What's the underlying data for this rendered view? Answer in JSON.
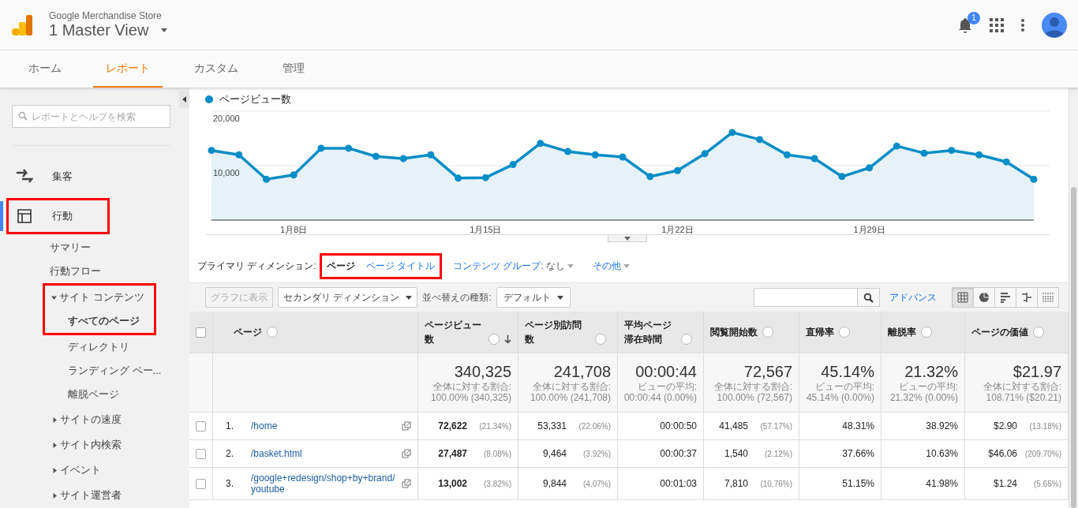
{
  "header": {
    "property": "Google Merchandise Store",
    "view": "1 Master View",
    "notification_count": "1"
  },
  "tabs": [
    {
      "label": "ホーム",
      "selected": false
    },
    {
      "label": "レポート",
      "selected": true
    },
    {
      "label": "カスタム",
      "selected": false
    },
    {
      "label": "管理",
      "selected": false
    }
  ],
  "sidebar": {
    "search_placeholder": "レポートとヘルプを検索",
    "sections": [
      {
        "kind": "acquisition",
        "label": "集客",
        "selected": false,
        "highlighted": false
      },
      {
        "kind": "behavior",
        "label": "行動",
        "selected": true,
        "highlighted": true,
        "children": [
          {
            "label": "サマリー",
            "selected": false
          },
          {
            "label": "行動フロー",
            "selected": false
          },
          {
            "label": "サイト コンテンツ",
            "expanded": true,
            "highlighted": true,
            "children": [
              {
                "label": "すべてのページ",
                "selected": true
              },
              {
                "label": "ディレクトリ",
                "selected": false
              },
              {
                "label": "ランディング ペー...",
                "selected": false
              },
              {
                "label": "離脱ページ",
                "selected": false
              }
            ]
          },
          {
            "label": "サイトの速度",
            "expanded": false
          },
          {
            "label": "サイト内検索",
            "expanded": false
          },
          {
            "label": "イベント",
            "expanded": false
          },
          {
            "label": "サイト運営者",
            "expanded": false
          }
        ]
      }
    ]
  },
  "chart": {
    "chart_data": {
      "type": "area",
      "categories": [
        null,
        null,
        null,
        "1月8日",
        null,
        null,
        null,
        null,
        null,
        null,
        "1月15日",
        null,
        null,
        null,
        null,
        null,
        null,
        "1月22日",
        null,
        null,
        null,
        null,
        null,
        null,
        "1月29日",
        null,
        null,
        null,
        null,
        null,
        null
      ],
      "yticks": [
        {
          "value": 10000,
          "label": "10,000"
        },
        {
          "value": 20000,
          "label": "20,000"
        }
      ],
      "ylim": [
        0,
        20000
      ],
      "series": [
        {
          "name": "ページビュー数",
          "color": "#058dc7",
          "values": [
            12800,
            12000,
            7500,
            8300,
            13200,
            13200,
            11700,
            11300,
            12000,
            7700,
            7800,
            10200,
            14100,
            12600,
            12000,
            11600,
            8000,
            9100,
            12200,
            16100,
            14800,
            12000,
            11300,
            8000,
            9600,
            13600,
            12300,
            12800,
            12000,
            10700,
            7500
          ]
        }
      ]
    }
  },
  "primary_dimension": {
    "label": "プライマリ ディメンション:",
    "highlighted": true,
    "options": [
      {
        "label": "ページ",
        "selected": true
      },
      {
        "label": "ページ タイトル",
        "selected": false
      }
    ],
    "content_group": {
      "label": "コンテンツ グループ:",
      "value": "なし"
    },
    "more": "その他"
  },
  "toolbar": {
    "graph_button": {
      "label": "グラフに表示",
      "disabled": true
    },
    "secondary_dimension": "セカンダリ ディメンション",
    "sort_label": "並べ替えの種類:",
    "sort_value": "デフォルト",
    "advanced": "アドバンス",
    "view_modes": [
      {
        "kind": "table",
        "selected": true
      },
      {
        "kind": "pie",
        "selected": false
      },
      {
        "kind": "bars",
        "selected": false
      },
      {
        "kind": "comparison",
        "selected": false
      },
      {
        "kind": "pivot",
        "selected": false
      }
    ]
  },
  "table": {
    "select_all_checked": false,
    "columns": [
      {
        "label": "ページ",
        "sorted": false
      },
      {
        "label": "ページビュー数",
        "sorted": true
      },
      {
        "label": "ページ別訪問数",
        "sorted": false
      },
      {
        "label": "平均ページ滞在時間",
        "sorted": false
      },
      {
        "label": "閲覧開始数",
        "sorted": false
      },
      {
        "label": "直帰率",
        "sorted": false
      },
      {
        "label": "離脱率",
        "sorted": false
      },
      {
        "label": "ページの価値",
        "sorted": false
      }
    ],
    "totals": [
      {
        "value": "340,325",
        "caption": "全体に対する割合:",
        "detail": "100.00% (340,325)"
      },
      {
        "value": "241,708",
        "caption": "全体に対する割合:",
        "detail": "100.00% (241,708)"
      },
      {
        "value": "00:00:44",
        "caption": "ビューの平均:",
        "detail": "00:00:44 (0.00%)"
      },
      {
        "value": "72,567",
        "caption": "全体に対する割合:",
        "detail": "100.00% (72,567)"
      },
      {
        "value": "45.14%",
        "caption": "ビューの平均:",
        "detail": "45.14% (0.00%)"
      },
      {
        "value": "21.32%",
        "caption": "ビューの平均:",
        "detail": "21.32% (0.00%)"
      },
      {
        "value": "$21.97",
        "caption": "全体に対する割合:",
        "detail": "108.71% ($20.21)"
      }
    ],
    "rows": [
      {
        "checked": false,
        "cells": [
          {
            "index": "1.",
            "value": "/home"
          },
          {
            "value": "72,622",
            "percent": "(21.34%)"
          },
          {
            "value": "53,331",
            "percent": "(22.06%)"
          },
          {
            "value": "00:00:50"
          },
          {
            "value": "41,485",
            "percent": "(57.17%)"
          },
          {
            "value": "48.31%"
          },
          {
            "value": "38.92%"
          },
          {
            "value": "$2.90",
            "percent": "(13.18%)"
          }
        ]
      },
      {
        "checked": false,
        "cells": [
          {
            "index": "2.",
            "value": "/basket.html"
          },
          {
            "value": "27,487",
            "percent": "(8.08%)"
          },
          {
            "value": "9,464",
            "percent": "(3.92%)"
          },
          {
            "value": "00:00:37"
          },
          {
            "value": "1,540",
            "percent": "(2.12%)"
          },
          {
            "value": "37.66%"
          },
          {
            "value": "10.63%"
          },
          {
            "value": "$46.06",
            "percent": "(209.70%)"
          }
        ]
      },
      {
        "checked": false,
        "cells": [
          {
            "index": "3.",
            "value": "/google+redesign/shop+by+brand/youtube"
          },
          {
            "value": "13,002",
            "percent": "(3.82%)"
          },
          {
            "value": "9,844",
            "percent": "(4.07%)"
          },
          {
            "value": "00:01:03"
          },
          {
            "value": "7,810",
            "percent": "(10.76%)"
          },
          {
            "value": "51.15%"
          },
          {
            "value": "41.98%"
          },
          {
            "value": "$1.24",
            "percent": "(5.65%)"
          }
        ]
      }
    ]
  }
}
